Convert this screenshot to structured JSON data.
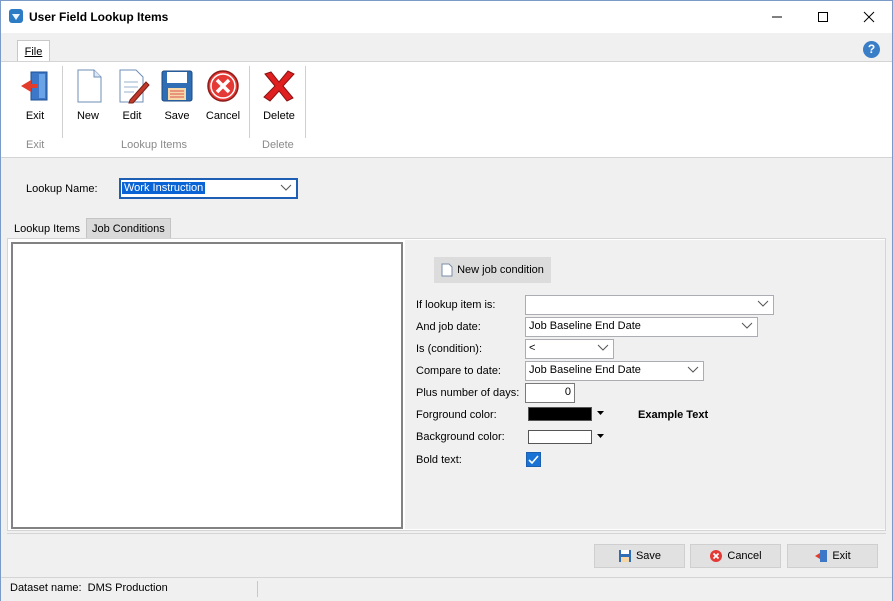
{
  "window": {
    "title": "User Field Lookup Items"
  },
  "ribbon": {
    "tab": "File",
    "buttons": {
      "exit": "Exit",
      "new": "New",
      "edit": "Edit",
      "save": "Save",
      "cancel": "Cancel",
      "delete": "Delete"
    },
    "groups": {
      "exit": "Exit",
      "lookup_items": "Lookup Items",
      "delete": "Delete"
    }
  },
  "lookup": {
    "label": "Lookup Name:",
    "value": "Work Instruction"
  },
  "tabs": [
    {
      "label": "Lookup Items"
    },
    {
      "label": "Job Conditions"
    }
  ],
  "conditions": {
    "new_button": "New job condition",
    "if_lookup_label": "If lookup item is:",
    "if_lookup_value": "",
    "job_date_label": "And job date:",
    "job_date_value": "Job Baseline End Date",
    "condition_label": "Is (condition):",
    "condition_value": "<",
    "compare_label": "Compare to date:",
    "compare_value": "Job Baseline End Date",
    "plus_days_label": "Plus number of days:",
    "plus_days_value": "0",
    "fg_label": "Forground color:",
    "fg_color": "#000000",
    "bg_label": "Background color:",
    "bg_color": "#ffffff",
    "example_text": "Example Text",
    "bold_label": "Bold text:",
    "bold_checked": true
  },
  "footer": {
    "save": "Save",
    "cancel": "Cancel",
    "exit": "Exit"
  },
  "status": {
    "dataset": "Dataset name:  DMS Production"
  }
}
